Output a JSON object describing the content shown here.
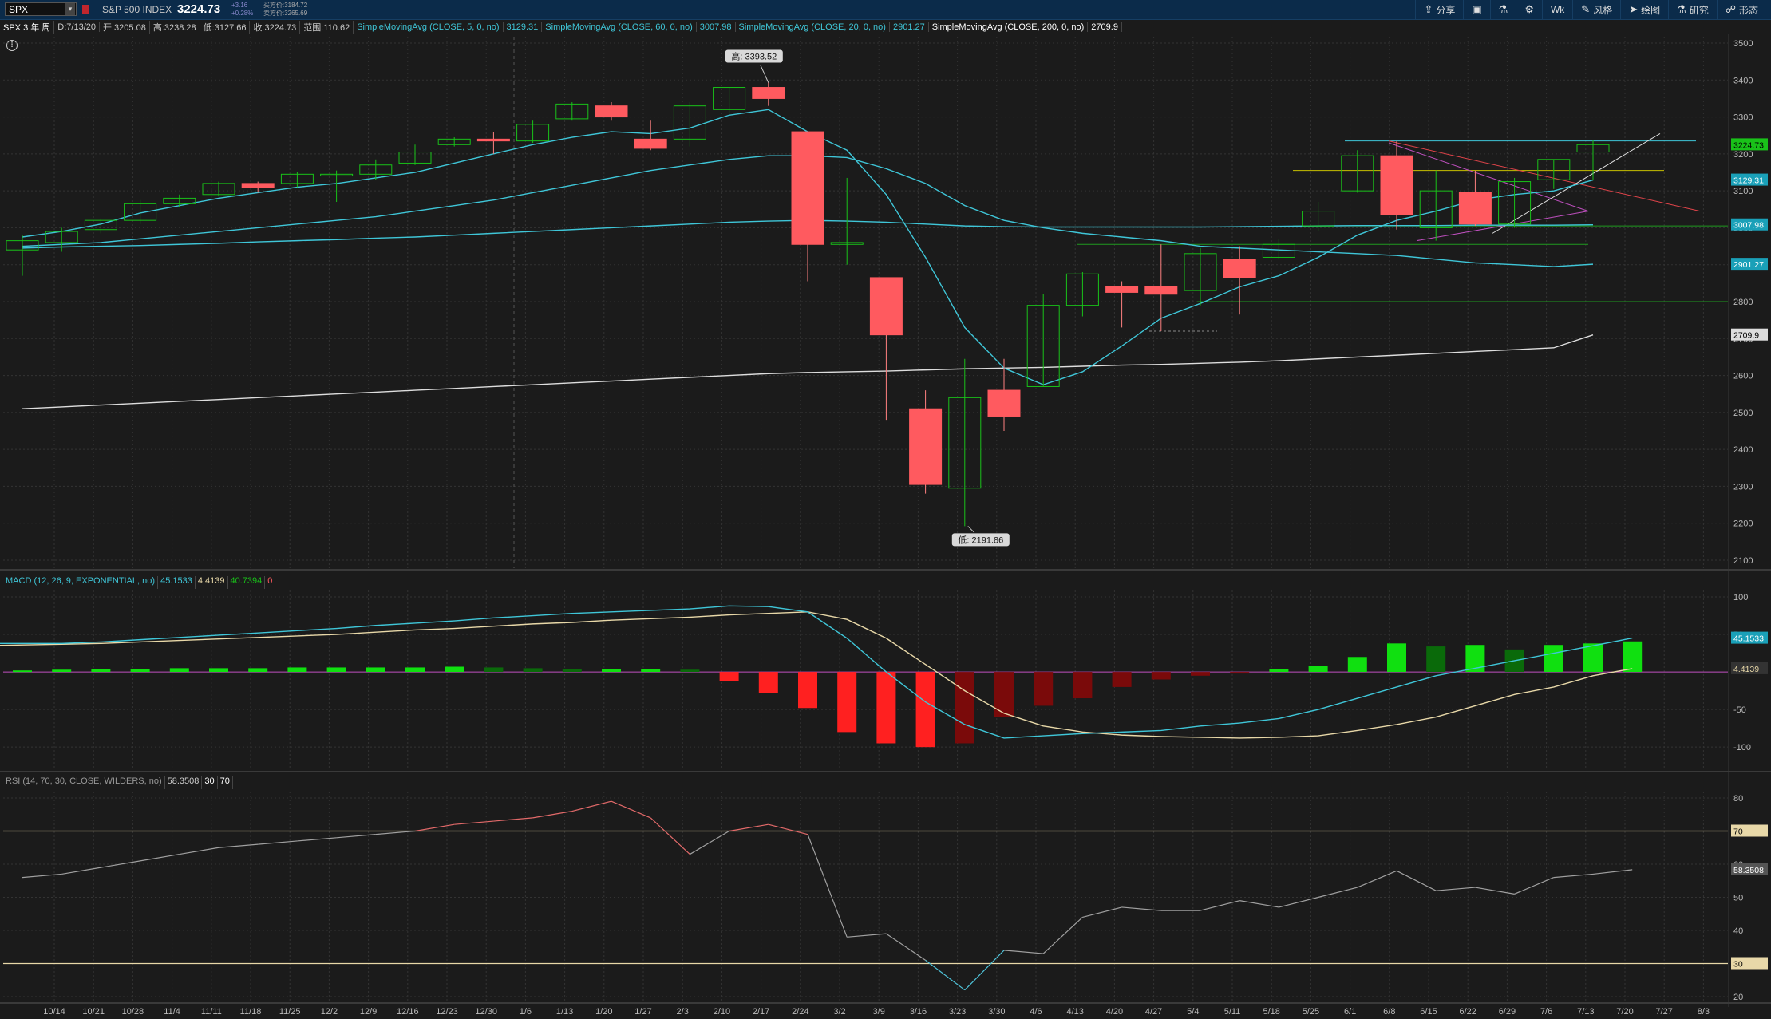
{
  "toolbar": {
    "symbol": "SPX",
    "index_name": "S&P 500 INDEX",
    "last_price": "3224.73",
    "change_abs": "+3.16",
    "change_pct": "+0.28%",
    "bid": "买方价:3184.72",
    "ask": "卖方价:3265.69",
    "buttons": [
      {
        "icon": "share-icon",
        "glyph": "⇪",
        "label": "分享"
      },
      {
        "icon": "save-icon",
        "glyph": "▣",
        "label": ""
      },
      {
        "icon": "flask-icon",
        "glyph": "⚗",
        "label": ""
      },
      {
        "icon": "gear-icon",
        "glyph": "⚙",
        "label": ""
      },
      {
        "icon": "timeframe",
        "glyph": "",
        "label": "Wk"
      },
      {
        "icon": "style-icon",
        "glyph": "✎",
        "label": "风格"
      },
      {
        "icon": "drawing-icon",
        "glyph": "➤",
        "label": "绘图"
      },
      {
        "icon": "studies-icon",
        "glyph": "⚗",
        "label": "研究"
      },
      {
        "icon": "patterns-icon",
        "glyph": "☍",
        "label": "形态"
      }
    ]
  },
  "info": {
    "title": "SPX 3 年 周",
    "date": "D:7/13/20",
    "open": "开:3205.08",
    "high": "高:3238.28",
    "low": "低:3127.66",
    "close": "收:3224.73",
    "range": "范围:110.62",
    "sma5_label": "SimpleMovingAvg (CLOSE, 5, 0, no)",
    "sma5_val": "3129.31",
    "sma60_label": "SimpleMovingAvg (CLOSE, 60, 0, no)",
    "sma60_val": "3007.98",
    "sma20_label": "SimpleMovingAvg (CLOSE, 20, 0, no)",
    "sma20_val": "2901.27",
    "sma200_label": "SimpleMovingAvg (CLOSE, 200, 0, no)",
    "sma200_val": "2709.9"
  },
  "macd_info": {
    "label": "MACD (12, 26, 9, EXPONENTIAL, no)",
    "value": "45.1533",
    "avg": "4.4139",
    "diff": "40.7394",
    "zero": "0"
  },
  "rsi_info": {
    "label": "RSI (14, 70, 30, CLOSE, WILDERS, no)",
    "value": "58.3508",
    "os": "30",
    "ob": "70"
  },
  "annotations": {
    "high_label": "高: 3393.52",
    "low_label": "低: 2191.86"
  },
  "colors": {
    "up": "#19c219",
    "down": "#ff5a5f",
    "ma_cyan": "#3fc6d8",
    "ma_white": "#dddddd",
    "macd_line": "#3fc6d8",
    "macd_avg": "#e8d8a8",
    "rsi_line": "#a0a0a0",
    "rsi_ob": "#e36a6a",
    "bg": "#1b1b1b",
    "grid": "#333333"
  },
  "chart_data": {
    "type": "candlestick",
    "price_axis": {
      "min": 2100,
      "max": 3500,
      "ticks": [
        2100,
        2200,
        2300,
        2400,
        2500,
        2600,
        2700,
        2800,
        2900,
        3000,
        3100,
        3200,
        3300,
        3400,
        3500
      ]
    },
    "x_ticks": [
      "10/14",
      "10/21",
      "10/28",
      "11/4",
      "11/11",
      "11/18",
      "11/25",
      "12/2",
      "12/9",
      "12/16",
      "12/23",
      "12/30",
      "1/6",
      "1/13",
      "1/20",
      "1/27",
      "2/3",
      "2/10",
      "2/17",
      "2/24",
      "3/2",
      "3/9",
      "3/16",
      "3/23",
      "3/30",
      "4/6",
      "4/13",
      "4/20",
      "4/27",
      "5/4",
      "5/11",
      "5/18",
      "5/25",
      "6/1",
      "6/8",
      "6/15",
      "6/22",
      "6/29",
      "7/6",
      "7/13",
      "7/20",
      "7/27",
      "8/3"
    ],
    "candles": [
      {
        "o": 2940,
        "h": 2980,
        "l": 2870,
        "c": 2965
      },
      {
        "o": 2960,
        "h": 3000,
        "l": 2935,
        "c": 2990
      },
      {
        "o": 2995,
        "h": 3025,
        "l": 2985,
        "c": 3020
      },
      {
        "o": 3020,
        "h": 3075,
        "l": 3010,
        "c": 3065
      },
      {
        "o": 3065,
        "h": 3090,
        "l": 3055,
        "c": 3080
      },
      {
        "o": 3090,
        "h": 3125,
        "l": 3085,
        "c": 3120
      },
      {
        "o": 3120,
        "h": 3125,
        "l": 3095,
        "c": 3110
      },
      {
        "o": 3120,
        "h": 3150,
        "l": 3110,
        "c": 3145
      },
      {
        "o": 3145,
        "h": 3155,
        "l": 3070,
        "c": 3145
      },
      {
        "o": 3145,
        "h": 3185,
        "l": 3130,
        "c": 3170
      },
      {
        "o": 3175,
        "h": 3225,
        "l": 3170,
        "c": 3205
      },
      {
        "o": 3225,
        "h": 3245,
        "l": 3220,
        "c": 3240
      },
      {
        "o": 3240,
        "h": 3260,
        "l": 3200,
        "c": 3235
      },
      {
        "o": 3235,
        "h": 3290,
        "l": 3230,
        "c": 3280
      },
      {
        "o": 3295,
        "h": 3340,
        "l": 3290,
        "c": 3335
      },
      {
        "o": 3330,
        "h": 3340,
        "l": 3290,
        "c": 3300
      },
      {
        "o": 3240,
        "h": 3290,
        "l": 3210,
        "c": 3215
      },
      {
        "o": 3240,
        "h": 3340,
        "l": 3220,
        "c": 3330
      },
      {
        "o": 3320,
        "h": 3380,
        "l": 3310,
        "c": 3380
      },
      {
        "o": 3380,
        "h": 3393,
        "l": 3330,
        "c": 3350
      },
      {
        "o": 3260,
        "h": 3260,
        "l": 2855,
        "c": 2955
      },
      {
        "o": 2955,
        "h": 3135,
        "l": 2900,
        "c": 2960
      },
      {
        "o": 2865,
        "h": 2865,
        "l": 2480,
        "c": 2710
      },
      {
        "o": 2510,
        "h": 2560,
        "l": 2280,
        "c": 2305
      },
      {
        "o": 2295,
        "h": 2645,
        "l": 2192,
        "c": 2540
      },
      {
        "o": 2560,
        "h": 2645,
        "l": 2450,
        "c": 2490
      },
      {
        "o": 2570,
        "h": 2820,
        "l": 2570,
        "c": 2790
      },
      {
        "o": 2790,
        "h": 2880,
        "l": 2760,
        "c": 2875
      },
      {
        "o": 2840,
        "h": 2855,
        "l": 2730,
        "c": 2825
      },
      {
        "o": 2840,
        "h": 2955,
        "l": 2720,
        "c": 2820
      },
      {
        "o": 2830,
        "h": 2945,
        "l": 2790,
        "c": 2930
      },
      {
        "o": 2915,
        "h": 2950,
        "l": 2765,
        "c": 2865
      },
      {
        "o": 2920,
        "h": 2970,
        "l": 2915,
        "c": 2955
      },
      {
        "o": 3005,
        "h": 3070,
        "l": 2990,
        "c": 3045
      },
      {
        "o": 3100,
        "h": 3210,
        "l": 3095,
        "c": 3195
      },
      {
        "o": 3195,
        "h": 3235,
        "l": 2995,
        "c": 3035
      },
      {
        "o": 3000,
        "h": 3155,
        "l": 2965,
        "c": 3100
      },
      {
        "o": 3095,
        "h": 3155,
        "l": 3005,
        "c": 3010
      },
      {
        "o": 3010,
        "h": 3135,
        "l": 3000,
        "c": 3125
      },
      {
        "o": 3130,
        "h": 3185,
        "l": 3105,
        "c": 3185
      },
      {
        "o": 3205,
        "h": 3238,
        "l": 3128,
        "c": 3225
      }
    ],
    "sma5": [
      2975,
      2990,
      3010,
      3040,
      3060,
      3080,
      3095,
      3110,
      3120,
      3135,
      3150,
      3175,
      3200,
      3225,
      3245,
      3260,
      3255,
      3270,
      3305,
      3320,
      3260,
      3210,
      3090,
      2920,
      2730,
      2620,
      2575,
      2610,
      2680,
      2755,
      2795,
      2840,
      2870,
      2920,
      2980,
      3020,
      3045,
      3075,
      3090,
      3100,
      3129.31
    ],
    "sma20": [
      2950,
      2955,
      2960,
      2970,
      2980,
      2990,
      3000,
      3010,
      3020,
      3030,
      3045,
      3060,
      3075,
      3095,
      3115,
      3135,
      3155,
      3170,
      3185,
      3195,
      3195,
      3190,
      3160,
      3120,
      3060,
      3020,
      3000,
      2985,
      2975,
      2965,
      2950,
      2945,
      2940,
      2935,
      2930,
      2925,
      2915,
      2905,
      2900,
      2895,
      2901.27
    ],
    "sma60": [
      2945,
      2948,
      2950,
      2952,
      2955,
      2958,
      2962,
      2965,
      2968,
      2972,
      2975,
      2980,
      2985,
      2990,
      2995,
      3000,
      3005,
      3010,
      3015,
      3018,
      3020,
      3018,
      3015,
      3010,
      3005,
      3003,
      3002,
      3002,
      3002,
      3002,
      3002,
      3003,
      3004,
      3005,
      3006,
      3006,
      3006,
      3007,
      3007,
      3007,
      3007.98
    ],
    "sma200": [
      2510,
      2515,
      2520,
      2525,
      2530,
      2535,
      2540,
      2545,
      2550,
      2555,
      2560,
      2565,
      2570,
      2575,
      2580,
      2585,
      2590,
      2595,
      2600,
      2605,
      2608,
      2610,
      2612,
      2615,
      2618,
      2620,
      2622,
      2625,
      2628,
      2630,
      2633,
      2636,
      2640,
      2645,
      2650,
      2655,
      2660,
      2665,
      2670,
      2675,
      2709.9
    ],
    "macd": {
      "axis": {
        "min": -120,
        "max": 100,
        "ticks": [
          100,
          50,
          -50,
          -100
        ]
      },
      "value": [
        38,
        38,
        38,
        40,
        43,
        46,
        49,
        52,
        55,
        58,
        62,
        65,
        68,
        72,
        75,
        78,
        80,
        82,
        84,
        88,
        87,
        80,
        45,
        0,
        -40,
        -70,
        -88,
        -85,
        -82,
        -80,
        -78,
        -72,
        -68,
        -62,
        -50,
        -35,
        -20,
        -5,
        5,
        15,
        25,
        35,
        45.1533
      ],
      "avg": [
        35,
        36,
        37,
        38,
        40,
        42,
        44,
        46,
        48,
        50,
        53,
        56,
        58,
        61,
        64,
        66,
        69,
        71,
        73,
        76,
        78,
        80,
        70,
        45,
        10,
        -25,
        -55,
        -72,
        -80,
        -84,
        -86,
        -87,
        -88,
        -87,
        -85,
        -78,
        -70,
        -60,
        -45,
        -30,
        -20,
        -5,
        4.4139
      ],
      "hist": [
        -3,
        -2,
        -1,
        2,
        3,
        4,
        4,
        5,
        5,
        5,
        6,
        6,
        6,
        6,
        7,
        6,
        5,
        4,
        4,
        4,
        3,
        -12,
        -28,
        -48,
        -80,
        -95,
        -100,
        -95,
        -60,
        -45,
        -35,
        -20,
        -10,
        -5,
        -2,
        4,
        8,
        20,
        38,
        34,
        36,
        30,
        36,
        38,
        40.7394
      ]
    },
    "rsi": {
      "axis": {
        "min": 20,
        "max": 80,
        "ticks": [
          80,
          70,
          60,
          50,
          40,
          30,
          20
        ]
      },
      "values": [
        56,
        57,
        59,
        61,
        63,
        65,
        66,
        67,
        68,
        69,
        70,
        72,
        73,
        74,
        76,
        79,
        74,
        63,
        70,
        72,
        69,
        38,
        39,
        31,
        22,
        34,
        33,
        44,
        47,
        46,
        46,
        49,
        47,
        50,
        53,
        58,
        52,
        53,
        51,
        56,
        57,
        58.3508
      ]
    }
  }
}
